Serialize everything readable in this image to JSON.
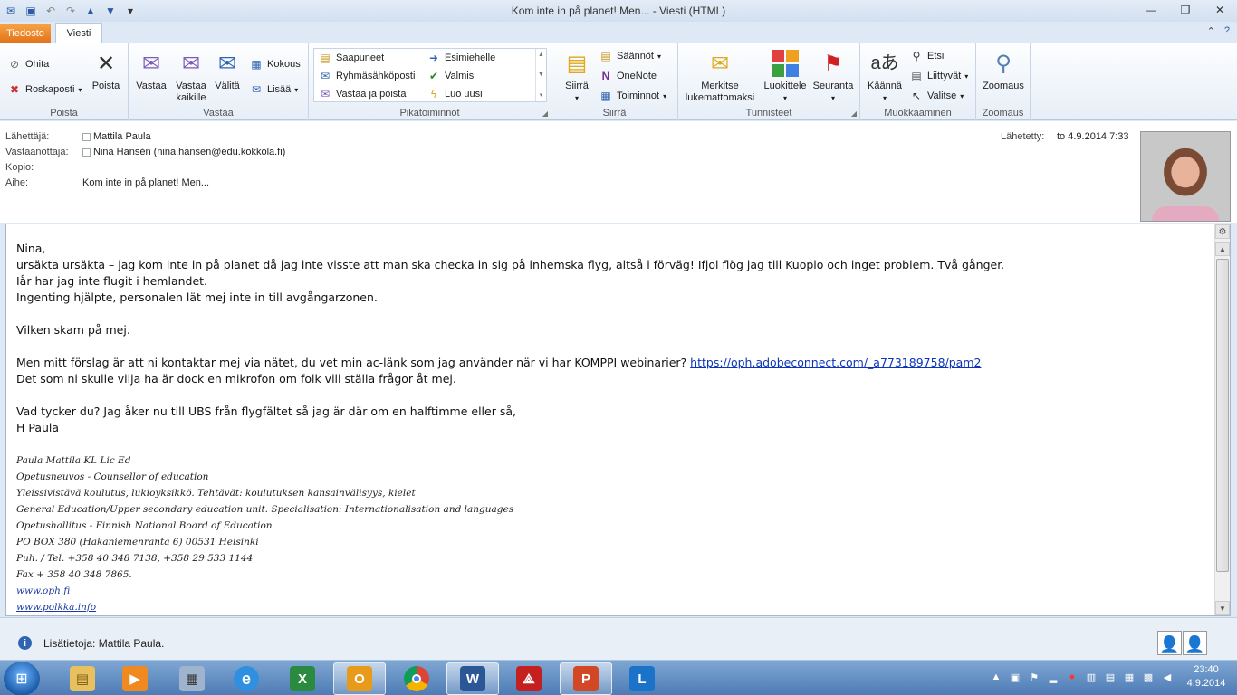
{
  "window": {
    "title": "Kom inte in på planet! Men... - Viesti (HTML)"
  },
  "tabs": {
    "file": "Tiedosto",
    "message": "Viesti"
  },
  "ribbon": {
    "ignore": "Ohita",
    "junk": "Roskaposti",
    "delete": "Poista",
    "group_delete": "Poista",
    "reply": "Vastaa",
    "reply_all": "Vastaa kaikille",
    "forward": "Välitä",
    "meeting": "Kokous",
    "more": "Lisää",
    "group_respond": "Vastaa",
    "quick": [
      "Saapuneet",
      "Esimiehelle",
      "Ryhmäsähköposti",
      "Valmis",
      "Vastaa ja poista",
      "Luo uusi"
    ],
    "group_quick": "Pikatoiminnot",
    "move": "Siirrä",
    "rules": "Säännöt",
    "onenote": "OneNote",
    "actions": "Toiminnot",
    "group_move": "Siirrä",
    "mark_unread": "Merkitse lukemattomaksi",
    "categorize": "Luokittele",
    "followup": "Seuranta",
    "group_tags": "Tunnisteet",
    "translate": "Käännä",
    "find": "Etsi",
    "related": "Liittyvät",
    "select": "Valitse",
    "group_edit": "Muokkaaminen",
    "zoom": "Zoomaus",
    "group_zoom": "Zoomaus"
  },
  "header": {
    "from_label": "Lähettäjä:",
    "from": "Mattila Paula",
    "to_label": "Vastaanottaja:",
    "to": "Nina Hansén (nina.hansen@edu.kokkola.fi)",
    "cc_label": "Kopio:",
    "subject_label": "Aihe:",
    "subject": "Kom inte in på planet! Men...",
    "sent_label": "Lähetetty:",
    "sent": "to 4.9.2014 7:33"
  },
  "body": {
    "greeting": "Nina,",
    "l1": "ursäkta ursäkta – jag kom inte in på planet då jag inte visste att man ska checka in sig på inhemska flyg, altså i förväg! Ifjol flög jag till Kuopio och inget problem. Två gånger.",
    "l2": "Iår har jag inte flugit i hemlandet.",
    "l3": "Ingenting hjälpte, personalen lät mej inte in till avgångarzonen.",
    "l4": "Vilken skam på mej.",
    "l5": "Men mitt förslag är att ni kontaktar mej via nätet, du vet min ac-länk som jag använder när vi har KOMPPI webinarier?",
    "link": "https://oph.adobeconnect.com/_a773189758/pam2",
    "l6": "Det som ni skulle vilja ha är dock en mikrofon om folk vill ställa frågor åt mej.",
    "l7": "Vad tycker du? Jag åker nu till UBS från flygfältet så jag är där om en halftimme eller så,",
    "l8": "H Paula",
    "sig": [
      "Paula Mattila KL  Lic Ed",
      "Opetusneuvos - Counsellor of education",
      "Yleissivistävä koulutus, lukioyksikkö. Tehtävät: koulutuksen kansainvälisyys, kielet",
      "General Education/Upper secondary education unit. Specialisation: Internationalisation and languages",
      "Opetushallitus - Finnish National Board of Education",
      "PO BOX 380 (Hakaniemenranta 6) 00531 Helsinki",
      "Puh. / Tel. +358 40 348 7138, +358 29 533 1144",
      "Fax + 358 40 348 7865."
    ],
    "sig_link1": "www.oph.fi",
    "sig_link2": "www.polkka.info"
  },
  "people": {
    "text": "Lisätietoja: Mattila Paula."
  },
  "taskbar": {
    "time": "23:40",
    "date": "4.9.2014"
  }
}
